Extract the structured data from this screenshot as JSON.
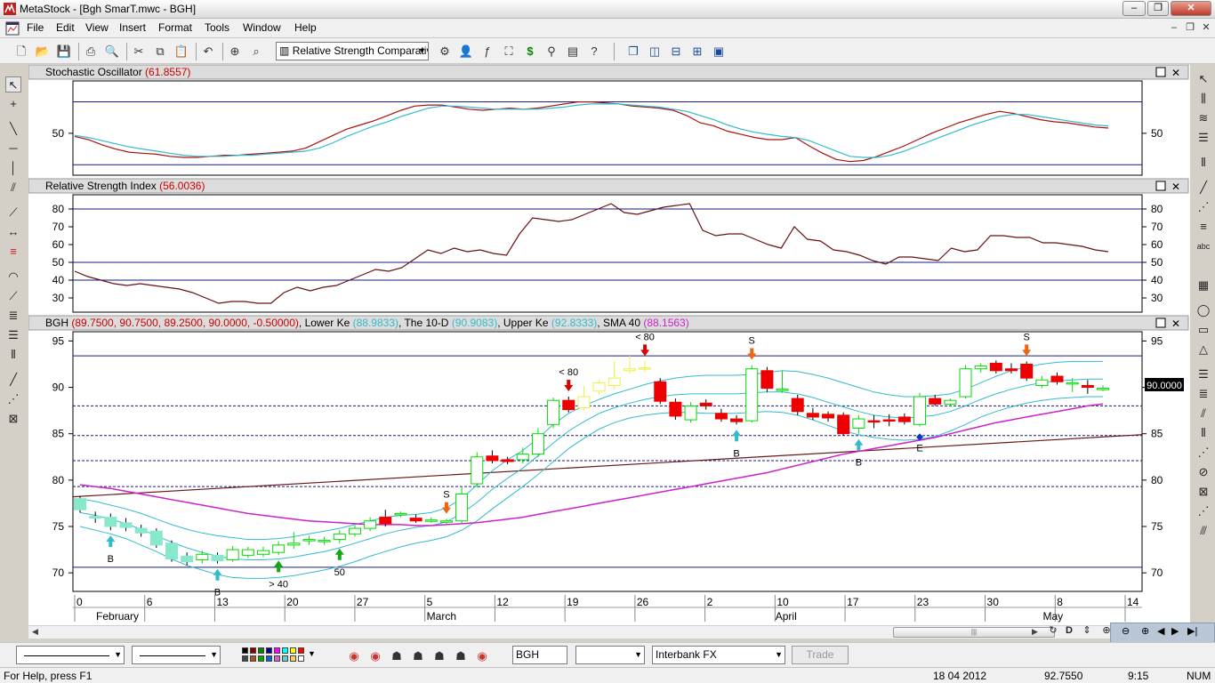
{
  "window": {
    "title": "MetaStock - [Bgh SmarT.mwc - BGH]",
    "buttons": {
      "minimize": "–",
      "maximize": "❐",
      "close": "✕"
    }
  },
  "menu": [
    "File",
    "Edit",
    "View",
    "Insert",
    "Format",
    "Tools",
    "Window",
    "Help"
  ],
  "toolbar": {
    "indicator_select": "Relative Strength Comparativ"
  },
  "panels": {
    "stochastic": {
      "name": "Stochastic Oscillator",
      "value": "(61.8557)"
    },
    "rsi": {
      "name": "Relative Strength Index",
      "value": "(56.0036)"
    },
    "price": {
      "symbol": "BGH",
      "ohlc": "(89.7500, 90.7500, 89.2500, 90.0000, -0.50000)",
      "lower_label": ", Lower Ke",
      "lower_val": "(88.9833)",
      "tend_label": ", The 10-D",
      "tend_val": "(90.9083)",
      "upper_label": ", Upper Ke",
      "upper_val": "(92.8333)",
      "sma_label": ", SMA 40",
      "sma_val": "(88.1563)",
      "last_price": "90.0000"
    }
  },
  "colors": {
    "bull_candle": "#00dd00",
    "bear_candle": "#ee0000",
    "stoch_k": "#aa1111",
    "stoch_d": "#33bbcc",
    "rsi_line": "#661111",
    "keltner": "#33bbcc",
    "sma": "#cc22cc",
    "trend": "#6a1a1a",
    "ref_line": "#1a1a80"
  },
  "chart_data": [
    {
      "type": "line",
      "series": [
        {
          "name": "K",
          "values": [
            47,
            44,
            39,
            35,
            32,
            31,
            30,
            28,
            27,
            27,
            28,
            29,
            29,
            30,
            31,
            32,
            33,
            36,
            42,
            48,
            54,
            58,
            62,
            67,
            72,
            76,
            77,
            77,
            75,
            73,
            72,
            73,
            74,
            73,
            74,
            76,
            78,
            80,
            80,
            79,
            78,
            76,
            75,
            74,
            72,
            67,
            60,
            57,
            52,
            49,
            46,
            44,
            44,
            46,
            38,
            31,
            25,
            23,
            24,
            28,
            33,
            38,
            44,
            50,
            55,
            60,
            64,
            68,
            71,
            69,
            66,
            63,
            61,
            60,
            58,
            56,
            55
          ]
        },
        {
          "name": "D",
          "values": [
            48,
            46,
            43,
            40,
            37,
            35,
            33,
            31,
            29,
            28,
            28,
            28,
            29,
            29,
            30,
            31,
            32,
            33,
            36,
            41,
            47,
            52,
            57,
            61,
            66,
            70,
            74,
            76,
            76,
            75,
            74,
            73,
            73,
            73,
            73,
            74,
            75,
            77,
            78,
            78,
            78,
            77,
            76,
            75,
            73,
            71,
            67,
            63,
            58,
            54,
            51,
            49,
            47,
            46,
            43,
            38,
            33,
            28,
            27,
            27,
            29,
            33,
            38,
            43,
            48,
            53,
            58,
            62,
            66,
            68,
            68,
            66,
            64,
            62,
            60,
            58,
            57
          ]
        }
      ],
      "reference_lines": [
        20,
        80
      ],
      "yticks": [
        50
      ],
      "ylim": [
        10,
        100
      ]
    },
    {
      "type": "line",
      "series": [
        {
          "name": "RSI",
          "values": [
            45,
            42,
            40,
            38,
            37,
            38,
            37,
            36,
            35,
            33,
            30,
            27,
            28,
            28,
            27,
            27,
            33,
            36,
            34,
            36,
            37,
            40,
            43,
            46,
            45,
            47,
            52,
            57,
            55,
            58,
            56,
            57,
            55,
            54,
            66,
            75,
            74,
            73,
            74,
            77,
            80,
            83,
            78,
            77,
            79,
            81,
            82,
            83,
            68,
            65,
            66,
            66,
            63,
            60,
            58,
            70,
            63,
            62,
            57,
            56,
            54,
            51,
            49,
            53,
            53,
            52,
            51,
            58,
            56,
            57,
            65,
            65,
            64,
            64,
            61,
            61,
            60,
            59,
            57,
            56
          ]
        }
      ],
      "reference_lines": [
        40,
        50,
        80
      ],
      "yticks": [
        30,
        40,
        50,
        60,
        70,
        80
      ],
      "ylim": [
        22,
        88
      ]
    },
    {
      "type": "candlestick",
      "symbol": "BGH",
      "x_ticks": [
        "0",
        "6",
        "13",
        "20",
        "27",
        "5",
        "12",
        "19",
        "26",
        "2",
        "10",
        "17",
        "23",
        "30",
        "8",
        "14"
      ],
      "months": [
        "February",
        "March",
        "April",
        "May"
      ],
      "yticks": [
        70,
        75,
        80,
        85,
        90,
        95
      ],
      "ylim": [
        68,
        96
      ],
      "candles": [
        {
          "o": 78.0,
          "c": 76.8,
          "h": 78.3,
          "l": 76.5
        },
        {
          "o": 76.1,
          "c": 75.9,
          "h": 76.6,
          "l": 75.4
        },
        {
          "o": 76.0,
          "c": 75.0,
          "h": 76.4,
          "l": 74.6
        },
        {
          "o": 75.4,
          "c": 74.9,
          "h": 75.9,
          "l": 74.5
        },
        {
          "o": 74.8,
          "c": 74.3,
          "h": 75.2,
          "l": 73.9
        },
        {
          "o": 74.5,
          "c": 73.0,
          "h": 74.8,
          "l": 72.7
        },
        {
          "o": 73.2,
          "c": 71.5,
          "h": 73.5,
          "l": 71.2
        },
        {
          "o": 71.8,
          "c": 71.2,
          "h": 72.2,
          "l": 70.8
        },
        {
          "o": 71.4,
          "c": 72.0,
          "h": 72.4,
          "l": 71.0
        },
        {
          "o": 71.9,
          "c": 71.3,
          "h": 72.2,
          "l": 71.0
        },
        {
          "o": 71.4,
          "c": 72.5,
          "h": 72.9,
          "l": 71.2
        },
        {
          "o": 71.9,
          "c": 72.5,
          "h": 72.8,
          "l": 71.6
        },
        {
          "o": 72.0,
          "c": 72.4,
          "h": 72.8,
          "l": 71.7
        },
        {
          "o": 72.2,
          "c": 73.0,
          "h": 73.4,
          "l": 71.9
        },
        {
          "o": 73.0,
          "c": 73.2,
          "h": 74.4,
          "l": 72.6
        },
        {
          "o": 73.6,
          "c": 73.6,
          "h": 74.0,
          "l": 73.0
        },
        {
          "o": 73.4,
          "c": 73.5,
          "h": 73.9,
          "l": 73.0
        },
        {
          "o": 73.6,
          "c": 74.2,
          "h": 74.6,
          "l": 73.2
        },
        {
          "o": 74.2,
          "c": 74.8,
          "h": 75.1,
          "l": 73.9
        },
        {
          "o": 74.8,
          "c": 75.6,
          "h": 76.0,
          "l": 74.5
        },
        {
          "o": 76.0,
          "c": 75.3,
          "h": 76.8,
          "l": 75.0
        },
        {
          "o": 76.4,
          "c": 76.4,
          "h": 76.6,
          "l": 76.0
        },
        {
          "o": 75.9,
          "c": 75.6,
          "h": 76.3,
          "l": 75.4
        },
        {
          "o": 75.6,
          "c": 75.7,
          "h": 76.0,
          "l": 75.4
        },
        {
          "o": 75.5,
          "c": 75.6,
          "h": 75.8,
          "l": 75.3
        },
        {
          "o": 75.6,
          "c": 78.5,
          "h": 79.2,
          "l": 75.3
        },
        {
          "o": 79.6,
          "c": 82.5,
          "h": 83.0,
          "l": 79.2
        },
        {
          "o": 82.6,
          "c": 82.1,
          "h": 83.2,
          "l": 81.8
        },
        {
          "o": 82.2,
          "c": 82.0,
          "h": 82.5,
          "l": 81.7
        },
        {
          "o": 82.2,
          "c": 82.8,
          "h": 83.5,
          "l": 81.8
        },
        {
          "o": 82.8,
          "c": 85.0,
          "h": 85.6,
          "l": 82.5
        },
        {
          "o": 86.0,
          "c": 88.6,
          "h": 88.9,
          "l": 85.6
        },
        {
          "o": 88.6,
          "c": 87.6,
          "h": 89.0,
          "l": 87.3
        },
        {
          "o": 87.8,
          "c": 89.0,
          "h": 90.2,
          "l": 87.5
        },
        {
          "o": 89.6,
          "c": 90.5,
          "h": 90.8,
          "l": 89.2
        },
        {
          "o": 90.2,
          "c": 91.0,
          "h": 92.8,
          "l": 89.8
        },
        {
          "o": 91.8,
          "c": 92.0,
          "h": 93.4,
          "l": 91.5
        },
        {
          "o": 92.0,
          "c": 92.1,
          "h": 92.8,
          "l": 91.6
        },
        {
          "o": 90.6,
          "c": 88.5,
          "h": 91.0,
          "l": 88.2
        },
        {
          "o": 88.4,
          "c": 86.9,
          "h": 88.8,
          "l": 86.5
        },
        {
          "o": 86.5,
          "c": 88.0,
          "h": 88.4,
          "l": 86.2
        },
        {
          "o": 88.3,
          "c": 88.0,
          "h": 88.7,
          "l": 87.6
        },
        {
          "o": 87.2,
          "c": 86.6,
          "h": 87.7,
          "l": 86.3
        },
        {
          "o": 86.6,
          "c": 86.3,
          "h": 87.0,
          "l": 86.0
        },
        {
          "o": 86.4,
          "c": 92.0,
          "h": 92.4,
          "l": 86.2
        },
        {
          "o": 91.8,
          "c": 89.9,
          "h": 92.2,
          "l": 89.5
        },
        {
          "o": 89.8,
          "c": 89.8,
          "h": 91.8,
          "l": 89.4
        },
        {
          "o": 88.8,
          "c": 87.4,
          "h": 89.2,
          "l": 87.0
        },
        {
          "o": 87.2,
          "c": 86.8,
          "h": 87.8,
          "l": 86.5
        },
        {
          "o": 87.1,
          "c": 86.7,
          "h": 87.4,
          "l": 86.3
        },
        {
          "o": 87.0,
          "c": 85.0,
          "h": 87.3,
          "l": 84.8
        },
        {
          "o": 85.6,
          "c": 86.6,
          "h": 87.0,
          "l": 85.0
        },
        {
          "o": 86.4,
          "c": 86.3,
          "h": 87.0,
          "l": 85.6
        },
        {
          "o": 86.5,
          "c": 86.4,
          "h": 87.1,
          "l": 85.8
        },
        {
          "o": 86.8,
          "c": 86.3,
          "h": 87.2,
          "l": 86.0
        },
        {
          "o": 86.0,
          "c": 89.0,
          "h": 89.4,
          "l": 85.8
        },
        {
          "o": 88.8,
          "c": 88.2,
          "h": 89.2,
          "l": 88.0
        },
        {
          "o": 88.2,
          "c": 88.6,
          "h": 88.8,
          "l": 87.9
        },
        {
          "o": 89.0,
          "c": 92.0,
          "h": 92.4,
          "l": 88.8
        },
        {
          "o": 92.0,
          "c": 92.3,
          "h": 92.6,
          "l": 91.6
        },
        {
          "o": 92.6,
          "c": 91.8,
          "h": 92.9,
          "l": 91.5
        },
        {
          "o": 92.0,
          "c": 91.8,
          "h": 92.6,
          "l": 91.5
        },
        {
          "o": 92.5,
          "c": 91.0,
          "h": 92.8,
          "l": 90.7
        },
        {
          "o": 90.2,
          "c": 90.8,
          "h": 91.2,
          "l": 89.9
        },
        {
          "o": 91.2,
          "c": 90.6,
          "h": 91.6,
          "l": 90.3
        },
        {
          "o": 90.4,
          "c": 90.5,
          "h": 91.0,
          "l": 89.5
        },
        {
          "o": 90.2,
          "c": 90.0,
          "h": 90.8,
          "l": 89.3
        },
        {
          "o": 89.8,
          "c": 89.9,
          "h": 90.2,
          "l": 89.6
        }
      ],
      "overlays": [
        {
          "name": "Upper Ke",
          "values": [
            78.0,
            77.7,
            77.3,
            76.9,
            76.4,
            75.8,
            75.2,
            74.7,
            74.3,
            74.0,
            73.8,
            73.6,
            73.6,
            73.7,
            73.9,
            74.2,
            74.5,
            74.8,
            75.2,
            75.6,
            76.0,
            76.2,
            76.3,
            76.5,
            77.0,
            78.0,
            79.5,
            81.0,
            82.2,
            83.2,
            84.5,
            86.0,
            87.2,
            88.0,
            88.7,
            89.3,
            89.8,
            90.3,
            90.7,
            91.0,
            91.2,
            91.3,
            91.3,
            91.3,
            91.4,
            91.6,
            91.8,
            91.7,
            91.4,
            91.0,
            90.5,
            90.0,
            89.5,
            89.2,
            89.0,
            89.0,
            89.1,
            89.3,
            89.8,
            90.5,
            91.2,
            91.8,
            92.2,
            92.5,
            92.7,
            92.8,
            92.8,
            92.8
          ]
        },
        {
          "name": "The 10-D",
          "values": [
            76.5,
            76.2,
            75.8,
            75.3,
            74.7,
            74.0,
            73.3,
            72.7,
            72.2,
            71.8,
            71.5,
            71.4,
            71.4,
            71.5,
            71.7,
            72.0,
            72.3,
            72.7,
            73.2,
            73.7,
            74.2,
            74.6,
            74.9,
            75.1,
            75.5,
            76.4,
            77.6,
            79.0,
            80.2,
            81.3,
            82.6,
            84.0,
            85.3,
            86.3,
            87.2,
            87.8,
            88.3,
            88.7,
            89.0,
            89.2,
            89.3,
            89.3,
            89.3,
            89.3,
            89.4,
            89.5,
            89.5,
            89.3,
            88.9,
            88.4,
            87.9,
            87.4,
            87.0,
            86.8,
            86.7,
            86.8,
            87.0,
            87.4,
            88.0,
            88.7,
            89.3,
            89.8,
            90.2,
            90.5,
            90.7,
            90.8,
            90.9,
            90.9
          ]
        },
        {
          "name": "Lower Ke",
          "values": [
            75.0,
            74.6,
            74.2,
            73.7,
            73.0,
            72.3,
            71.5,
            70.8,
            70.3,
            69.8,
            69.5,
            69.4,
            69.4,
            69.5,
            69.7,
            70.0,
            70.3,
            70.7,
            71.2,
            71.8,
            72.3,
            72.8,
            73.2,
            73.5,
            73.9,
            74.6,
            75.6,
            76.9,
            78.1,
            79.3,
            80.6,
            82.0,
            83.4,
            84.5,
            85.5,
            86.2,
            86.7,
            87.0,
            87.2,
            87.3,
            87.3,
            87.2,
            87.2,
            87.2,
            87.3,
            87.4,
            87.3,
            87.0,
            86.5,
            85.9,
            85.3,
            84.9,
            84.6,
            84.4,
            84.3,
            84.4,
            84.7,
            85.3,
            86.0,
            86.8,
            87.4,
            87.9,
            88.3,
            88.6,
            88.8,
            88.9,
            89.0,
            89.0
          ]
        },
        {
          "name": "SMA 40",
          "values": [
            79.5,
            79.3,
            79.1,
            78.8,
            78.5,
            78.2,
            77.9,
            77.6,
            77.3,
            77.0,
            76.7,
            76.4,
            76.2,
            76.0,
            75.8,
            75.6,
            75.5,
            75.4,
            75.3,
            75.2,
            75.2,
            75.2,
            75.1,
            75.1,
            75.2,
            75.3,
            75.4,
            75.6,
            75.8,
            76.0,
            76.3,
            76.6,
            76.9,
            77.2,
            77.5,
            77.8,
            78.1,
            78.4,
            78.7,
            79.0,
            79.3,
            79.6,
            79.9,
            80.2,
            80.5,
            80.8,
            81.2,
            81.6,
            82.0,
            82.4,
            82.8,
            83.1,
            83.4,
            83.7,
            84.0,
            84.3,
            84.6,
            85.0,
            85.4,
            85.8,
            86.2,
            86.5,
            86.8,
            87.1,
            87.4,
            87.7,
            88.0,
            88.2
          ]
        }
      ],
      "trend_line": {
        "from": 78.2,
        "to": 84.9
      },
      "horizontal_lines": [
        93.4,
        88.0,
        84.8,
        82.1,
        79.3,
        70.6
      ],
      "signals": [
        {
          "label": "B",
          "i": 2
        },
        {
          "label": "B",
          "i": 9
        },
        {
          "label": "> 40",
          "i": 13
        },
        {
          "label": "50",
          "i": 17
        },
        {
          "label": "S",
          "i": 24
        },
        {
          "label": "< 80",
          "i": 32
        },
        {
          "label": "< 80",
          "i": 37
        },
        {
          "label": "S",
          "i": 44
        },
        {
          "label": "B",
          "i": 43
        },
        {
          "label": "B",
          "i": 51
        },
        {
          "label": "E",
          "i": 55
        },
        {
          "label": "S",
          "i": 62
        }
      ]
    }
  ],
  "bottombar": {
    "symbol": "BGH",
    "broker": "Interbank FX",
    "trade": "Trade"
  },
  "status": {
    "help": "For Help, press F1",
    "date": "18 04 2012",
    "price": "92.7550",
    "clock": "9:15",
    "num": "NUM"
  }
}
